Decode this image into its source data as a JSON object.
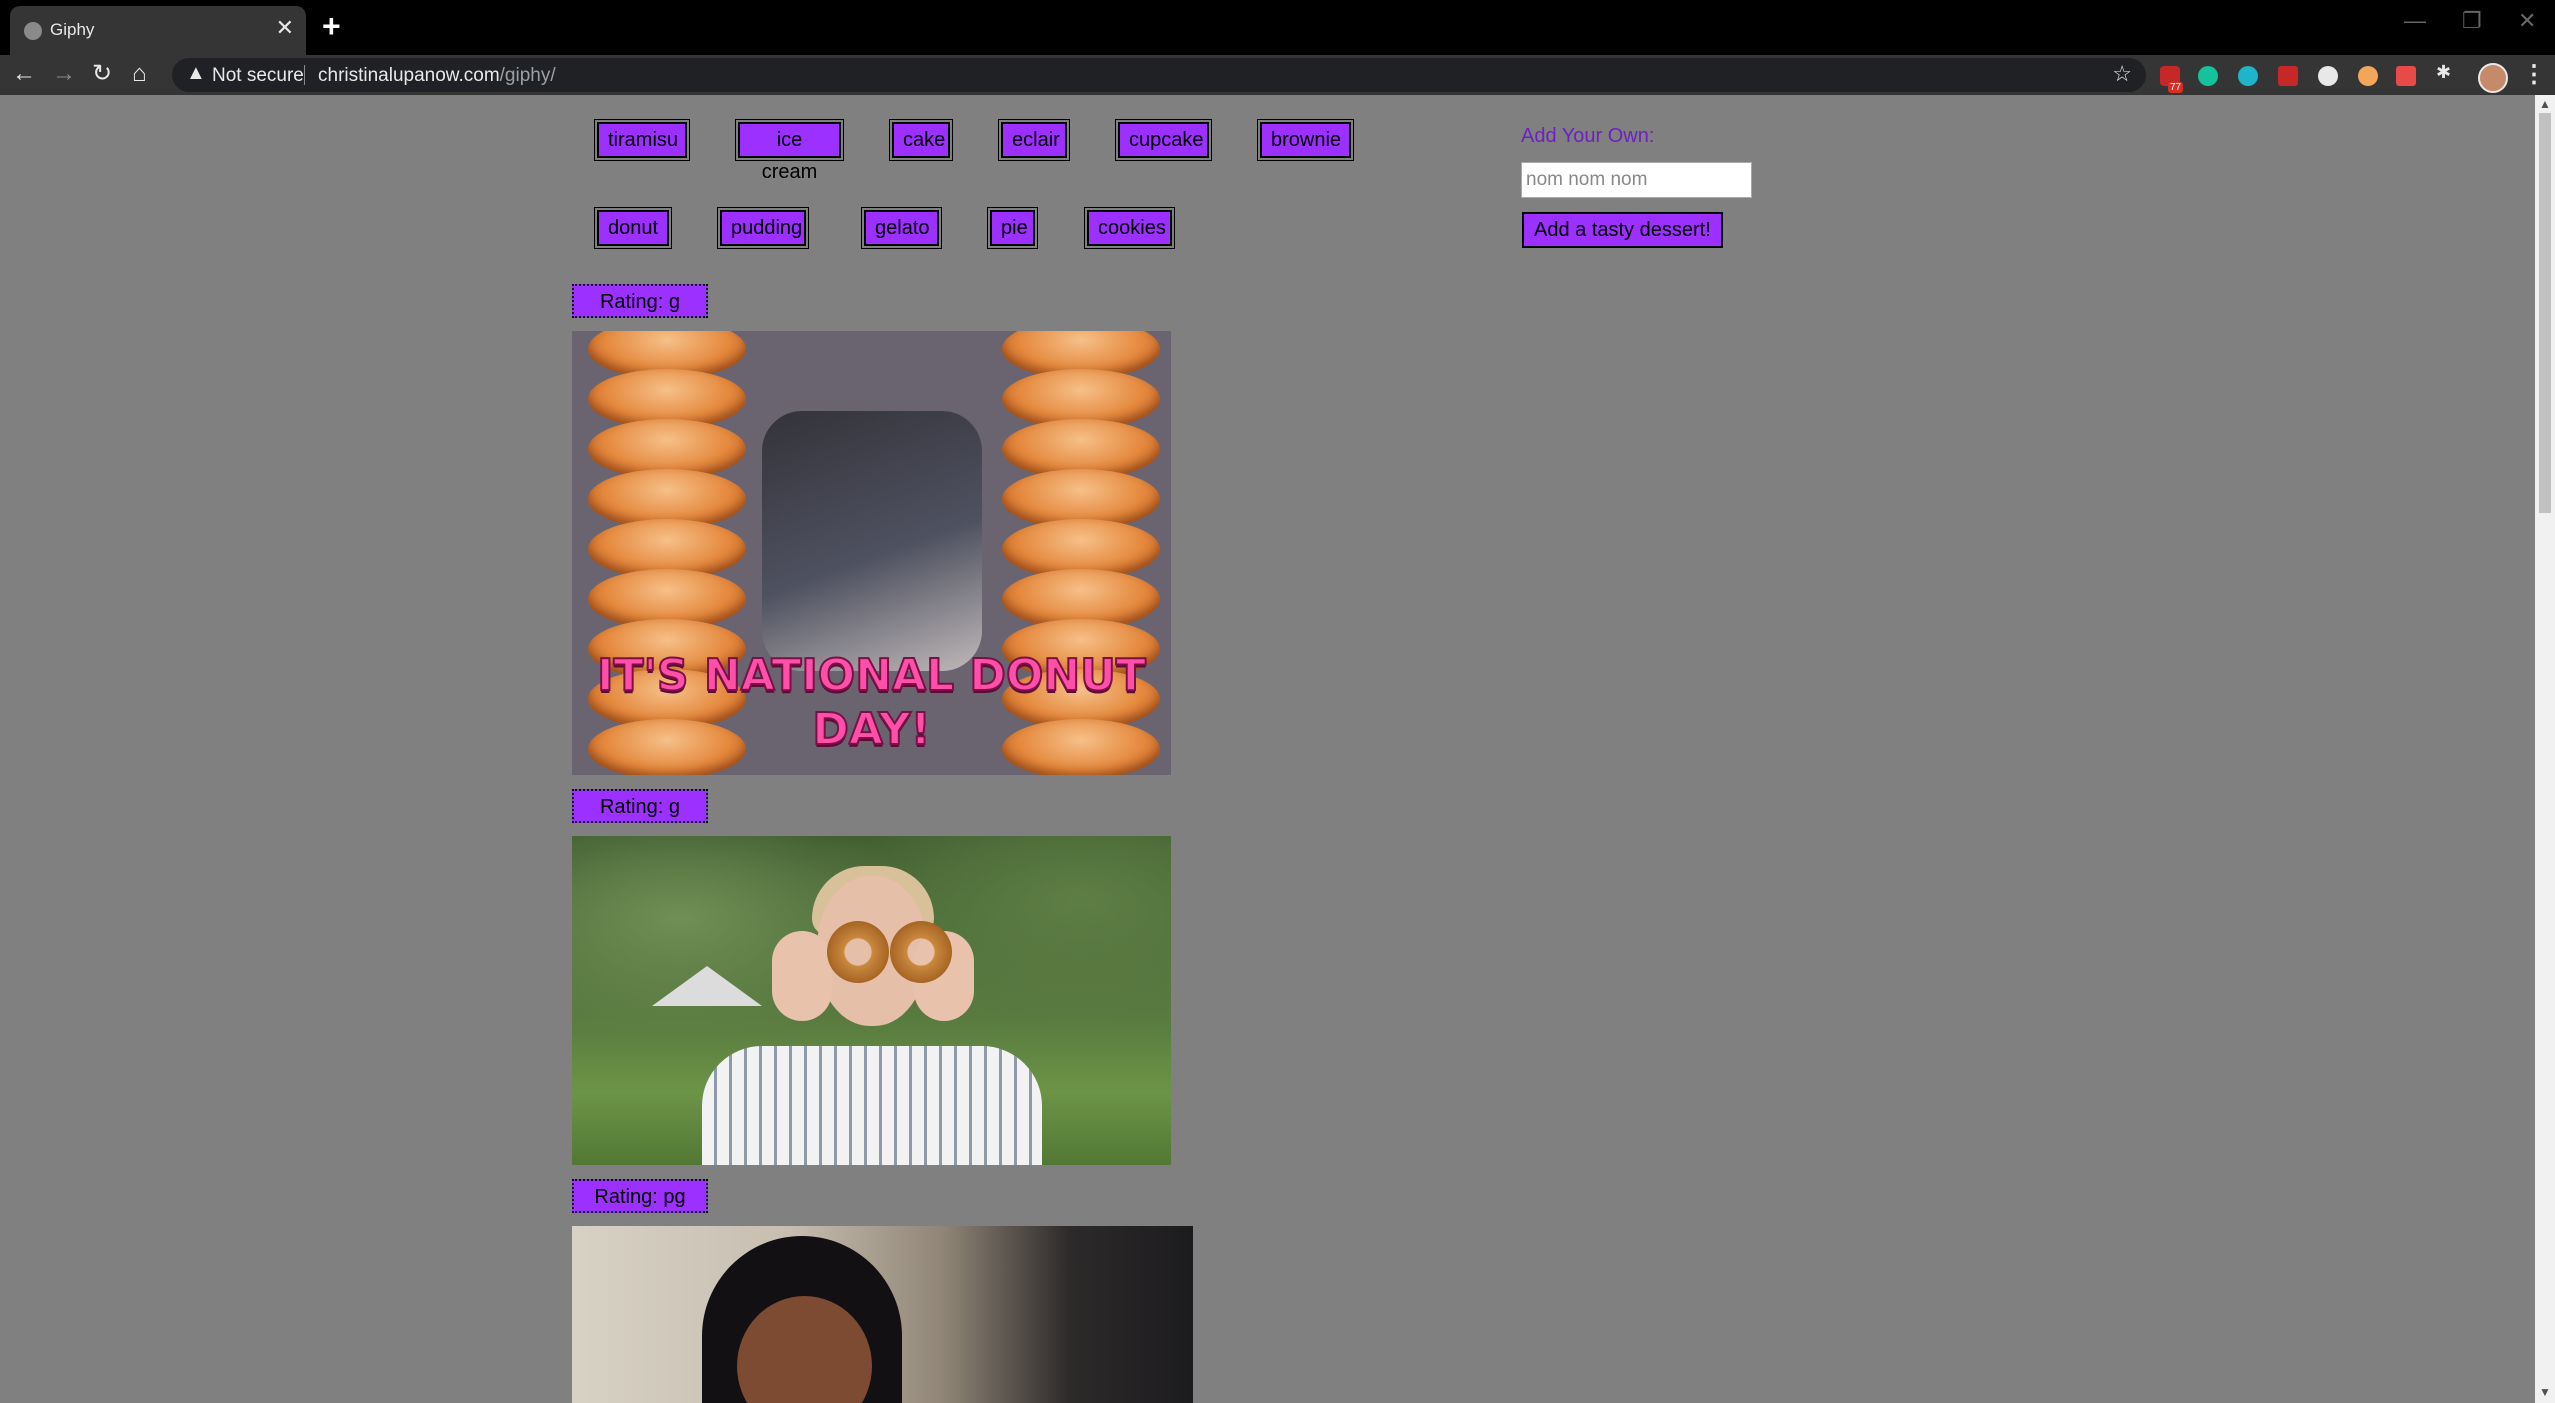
{
  "browser": {
    "tab_title": "Giphy",
    "tab_close": "✕",
    "new_tab": "+",
    "security_label": "Not secure",
    "url_host": "christinalupanow.com",
    "url_path": "/giphy/",
    "extension_badge": "77"
  },
  "topics_row1": [
    "tiramisu",
    "ice cream",
    "cake",
    "eclair",
    "cupcake",
    "brownie"
  ],
  "topics_row2": [
    "donut",
    "pudding",
    "gelato",
    "pie",
    "cookies"
  ],
  "add_form": {
    "label": "Add Your Own:",
    "placeholder": "nom nom nom",
    "button": "Add a tasty dessert!"
  },
  "results": [
    {
      "rating": "Rating: g",
      "caption": "IT'S NATIONAL DONUT DAY!"
    },
    {
      "rating": "Rating: g"
    },
    {
      "rating": "Rating: pg"
    }
  ],
  "colors": {
    "page_bg": "#808080",
    "button_bg": "#9b30ff",
    "label_text": "#6e20c4"
  }
}
